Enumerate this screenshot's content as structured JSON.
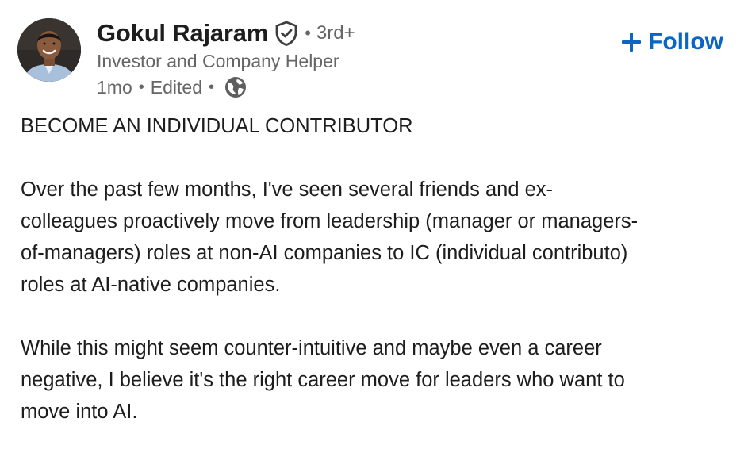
{
  "author": {
    "name": "Gokul Rajaram",
    "degree": "3rd+",
    "headline": "Investor and Company Helper",
    "time": "1mo",
    "edited": "Edited",
    "verified_icon": "verified-shield-icon",
    "visibility_icon": "globe-icon",
    "avatar_alt": "avatar"
  },
  "follow": {
    "label": "Follow",
    "icon": "plus-icon",
    "color": "#0a66c2"
  },
  "post": {
    "title": "BECOME AN INDIVIDUAL CONTRIBUTOR",
    "paragraphs": [
      "Over the past few months, I've seen several friends and ex-\ncolleagues proactively move from leadership (manager or managers-\nof-managers) roles at non-AI companies to IC (individual contributo)\nroles at AI-native companies.",
      "While this might seem counter-intuitive and maybe even a career\nnegative, I believe it's the right career move for leaders who want to\nmove into AI."
    ]
  },
  "colors": {
    "text_primary": "#1d1d1d",
    "text_secondary": "#666666",
    "background": "#ffffff"
  }
}
